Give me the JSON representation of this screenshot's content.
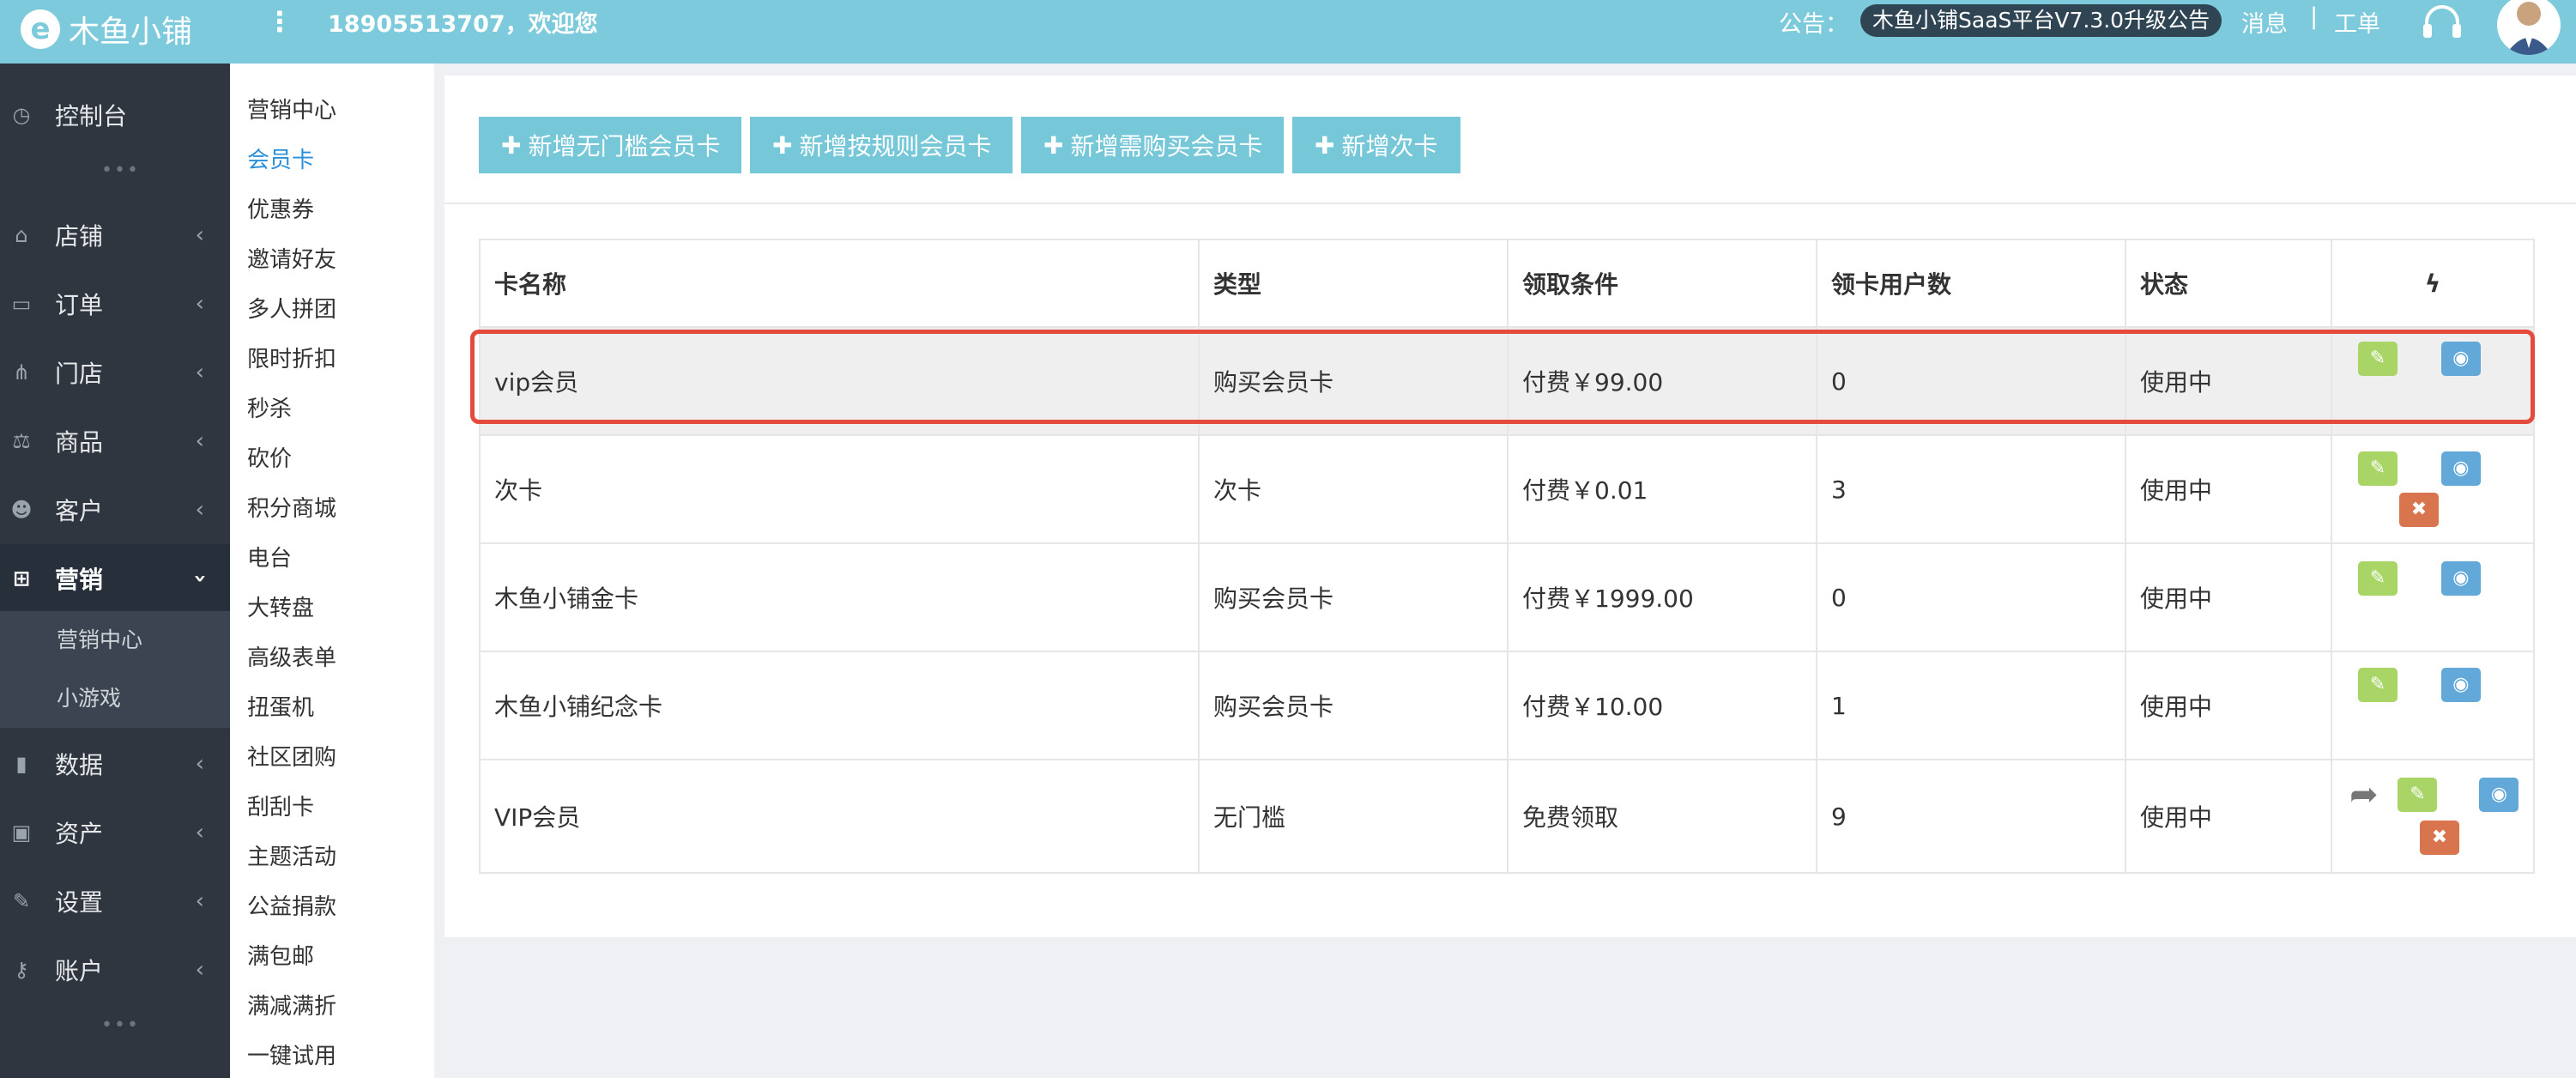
{
  "topbar": {
    "logo_text": "木鱼小铺",
    "welcome": "18905513707，欢迎您",
    "notice_label": "公告：",
    "notice_text": "木鱼小铺SaaS平台V7.3.0升级公告",
    "messages": "消息",
    "separator": "|",
    "tickets": "工单"
  },
  "sidebar": {
    "items": [
      {
        "label": "控制台",
        "icon": "dashboard-icon"
      },
      {
        "label": "店铺",
        "icon": "store-icon"
      },
      {
        "label": "订单",
        "icon": "order-icon"
      },
      {
        "label": "门店",
        "icon": "branch-icon"
      },
      {
        "label": "商品",
        "icon": "goods-icon"
      },
      {
        "label": "客户",
        "icon": "customer-icon"
      },
      {
        "label": "营销",
        "icon": "gift-icon"
      },
      {
        "label": "数据",
        "icon": "chart-icon"
      },
      {
        "label": "资产",
        "icon": "money-icon"
      },
      {
        "label": "设置",
        "icon": "wrench-icon"
      },
      {
        "label": "账户",
        "icon": "key-icon"
      }
    ],
    "sub_items": [
      "营销中心",
      "小游戏"
    ],
    "dots": "•••"
  },
  "submenu": {
    "items": [
      "营销中心",
      "会员卡",
      "优惠券",
      "邀请好友",
      "多人拼团",
      "限时折扣",
      "秒杀",
      "砍价",
      "积分商城",
      "电台",
      "大转盘",
      "高级表单",
      "扭蛋机",
      "社区团购",
      "刮刮卡",
      "主题活动",
      "公益捐款",
      "满包邮",
      "满减满折",
      "一键试用"
    ],
    "active_index": 1
  },
  "actions": {
    "buttons": [
      "新增无门槛会员卡",
      "新增按规则会员卡",
      "新增需购买会员卡",
      "新增次卡"
    ]
  },
  "table": {
    "headers": [
      "卡名称",
      "类型",
      "领取条件",
      "领卡用户数",
      "状态"
    ],
    "ops_header_icon": "lightning-icon",
    "rows": [
      {
        "name": "vip会员",
        "type": "购买会员卡",
        "condition": "付费￥99.00",
        "count": "0",
        "status": "使用中"
      },
      {
        "name": "次卡",
        "type": "次卡",
        "condition": "付费￥0.01",
        "count": "3",
        "status": "使用中"
      },
      {
        "name": "木鱼小铺金卡",
        "type": "购买会员卡",
        "condition": "付费￥1999.00",
        "count": "0",
        "status": "使用中"
      },
      {
        "name": "木鱼小铺纪念卡",
        "type": "购买会员卡",
        "condition": "付费￥10.00",
        "count": "1",
        "status": "使用中"
      },
      {
        "name": "VIP会员",
        "type": "无门槛",
        "condition": "免费领取",
        "count": "9",
        "status": "使用中"
      }
    ]
  },
  "colors": {
    "topbar": "#7ccadb",
    "sidebar": "#2f3640",
    "button": "#76c8d9",
    "edit": "#a8d566",
    "view": "#62a8d9",
    "delete": "#d9754e",
    "highlight": "#e54b3c",
    "active_link": "#2a8fd8"
  }
}
